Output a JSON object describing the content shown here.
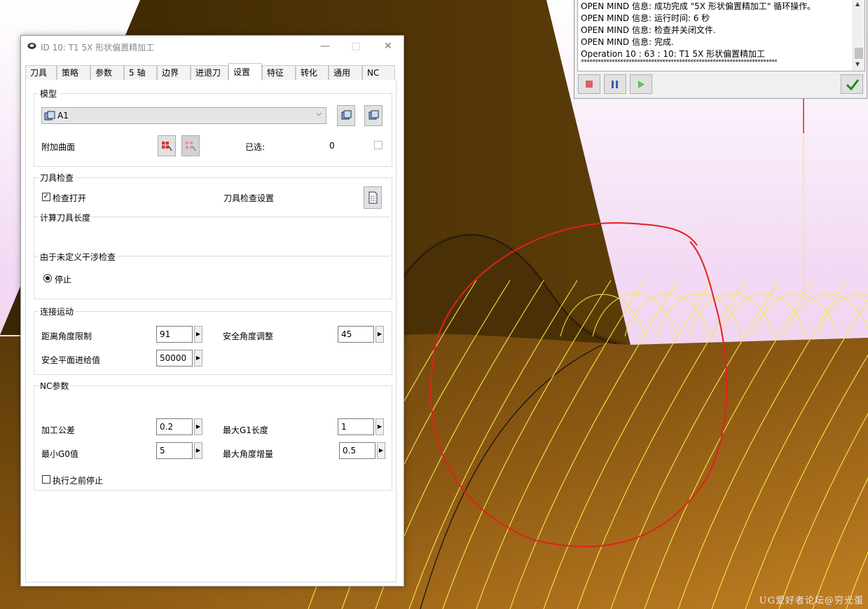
{
  "dialog": {
    "title": "ID 10: T1 5X 形状偏置精加工",
    "tabs": [
      "刀具",
      "策略",
      "参数",
      "5 轴",
      "边界",
      "进退刀",
      "设置",
      "特征",
      "转化",
      "通用",
      "NC"
    ],
    "active_tab": "设置"
  },
  "model": {
    "title": "模型",
    "selected": "A1",
    "additional_surfaces_label": "附加曲面",
    "selected_label": "已选:",
    "selected_count": "0"
  },
  "tool_check": {
    "title": "刀具检查",
    "check_on_label": "检查打开",
    "settings_label": "刀具检查设置",
    "compute_length_label": "计算刀具长度",
    "undefined_check_label": "由于未定义干涉检查",
    "stop_label": "停止"
  },
  "links": {
    "title": "连接运动",
    "distance_angle_label": "距离角度限制",
    "distance_angle_value": "91",
    "safe_angle_label": "安全角度调整",
    "safe_angle_value": "45",
    "safe_plane_feed_label": "安全平面进给值",
    "safe_plane_feed_value": "50000"
  },
  "nc": {
    "title": "NC参数",
    "tolerance_label": "加工公差",
    "tolerance_value": "0.2",
    "max_g1_label": "最大G1长度",
    "max_g1_value": "1",
    "min_g0_label": "最小G0值",
    "min_g0_value": "5",
    "max_angle_label": "最大角度增量",
    "max_angle_value": "0.5",
    "stop_before_label": "执行之前停止"
  },
  "log": {
    "lines": [
      "OPEN MIND 信息:      成功完成 \"5X 形状偏置精加工\" 循环操作。",
      "OPEN MIND 信息:      运行时间: 6 秒",
      "OPEN MIND 信息:      检查并关闭文件.",
      "OPEN MIND 信息:      完成.",
      "Operation 10 : 63 :   10: T1 5X 形状偏置精加工",
      "**********************************************************************"
    ]
  },
  "watermark": "UG爱好者论坛@穷光蛋",
  "colors": {
    "accent_red": "#e02020",
    "toolpath_yellow": "#f5e94a",
    "surface_brown": "#8a5410",
    "background_pink": "#f4dff5"
  }
}
